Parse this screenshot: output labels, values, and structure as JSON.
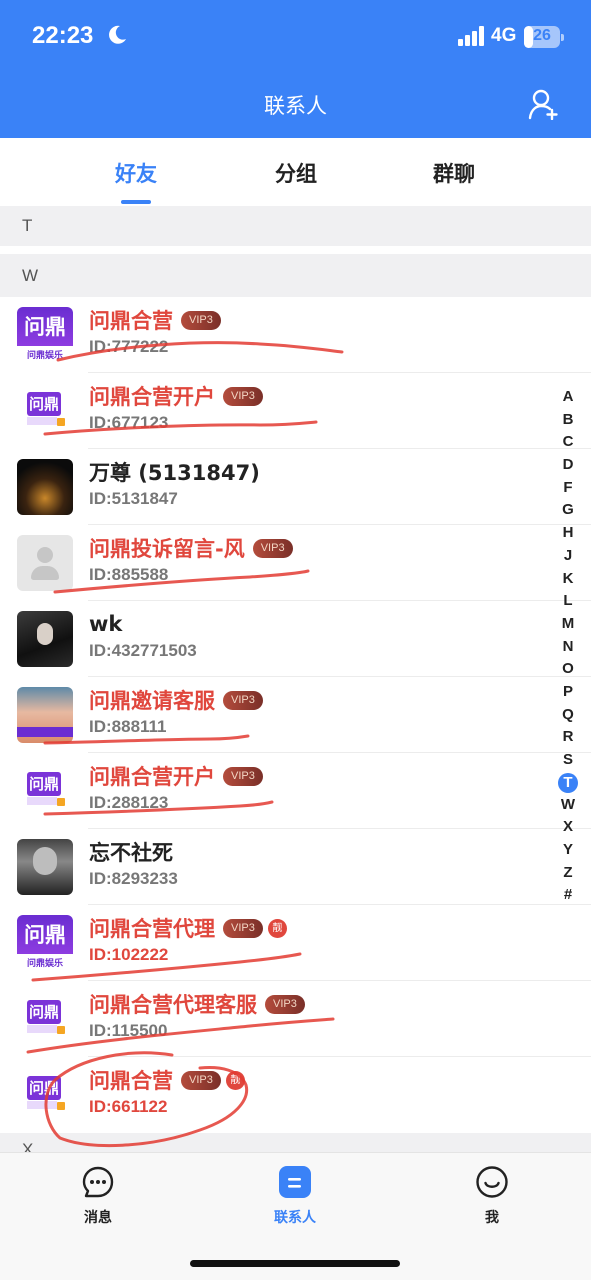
{
  "status_bar": {
    "time": "22:23",
    "network": "4G",
    "battery": "26",
    "battery_level": 0.26
  },
  "header": {
    "title": "联系人"
  },
  "tabs": [
    {
      "label": "好友",
      "active": true
    },
    {
      "label": "分组",
      "active": false
    },
    {
      "label": "群聊",
      "active": false
    }
  ],
  "sections": {
    "t": "T",
    "w": "W",
    "x": "X"
  },
  "contacts": [
    {
      "name": "问鼎合营",
      "vip": "VIP3",
      "id": "ID:777222",
      "red": true,
      "avatar": "brand-logo"
    },
    {
      "name": "问鼎合营开户",
      "vip": "VIP3",
      "id": "ID:677123",
      "red": true,
      "avatar": "brand-logo-small"
    },
    {
      "name": "万尊 (5131847)",
      "vip": "",
      "id": "ID:5131847",
      "red": false,
      "avatar": "dark-photo"
    },
    {
      "name": "问鼎投诉留言-风",
      "vip": "VIP3",
      "id": "ID:885588",
      "red": true,
      "avatar": "default-avatar"
    },
    {
      "name": "wk",
      "vip": "",
      "id": "ID:432771503",
      "red": false,
      "avatar": "night-photo"
    },
    {
      "name": "问鼎邀请客服",
      "vip": "VIP3",
      "id": "ID:888111",
      "red": true,
      "avatar": "selfie-photo"
    },
    {
      "name": "问鼎合营开户",
      "vip": "VIP3",
      "id": "ID:288123",
      "red": true,
      "avatar": "brand-logo-small"
    },
    {
      "name": "忘不社死",
      "vip": "",
      "id": "ID:8293233",
      "red": false,
      "avatar": "bw-photo"
    },
    {
      "name": "问鼎合营代理",
      "vip": "VIP3",
      "badge": "靓",
      "id": "ID:102222",
      "red": true,
      "id_red": true,
      "avatar": "brand-logo"
    },
    {
      "name": "问鼎合营代理客服",
      "vip": "VIP3",
      "id": "ID:115500",
      "red": true,
      "avatar": "brand-logo-small"
    },
    {
      "name": "问鼎合营",
      "vip": "VIP3",
      "badge": "靓",
      "id": "ID:661122",
      "red": true,
      "id_red": true,
      "avatar": "brand-logo-small"
    }
  ],
  "avatar_text": {
    "brand_top": "问鼎",
    "brand_bottom": "问鼎娱乐"
  },
  "index_letters": [
    "A",
    "B",
    "C",
    "D",
    "F",
    "G",
    "H",
    "J",
    "K",
    "L",
    "M",
    "N",
    "O",
    "P",
    "Q",
    "R",
    "S",
    "T",
    "W",
    "X",
    "Y",
    "Z",
    "#"
  ],
  "index_active": "T",
  "bottom_tabs": [
    {
      "label": "消息",
      "icon": "chat-bubble-icon",
      "active": false
    },
    {
      "label": "联系人",
      "icon": "contacts-icon",
      "active": true
    },
    {
      "label": "我",
      "icon": "smiley-icon",
      "active": false
    }
  ],
  "colors": {
    "primary": "#3a82f7",
    "highlight_red": "#e0473d",
    "scribble_red": "#e33b32"
  }
}
